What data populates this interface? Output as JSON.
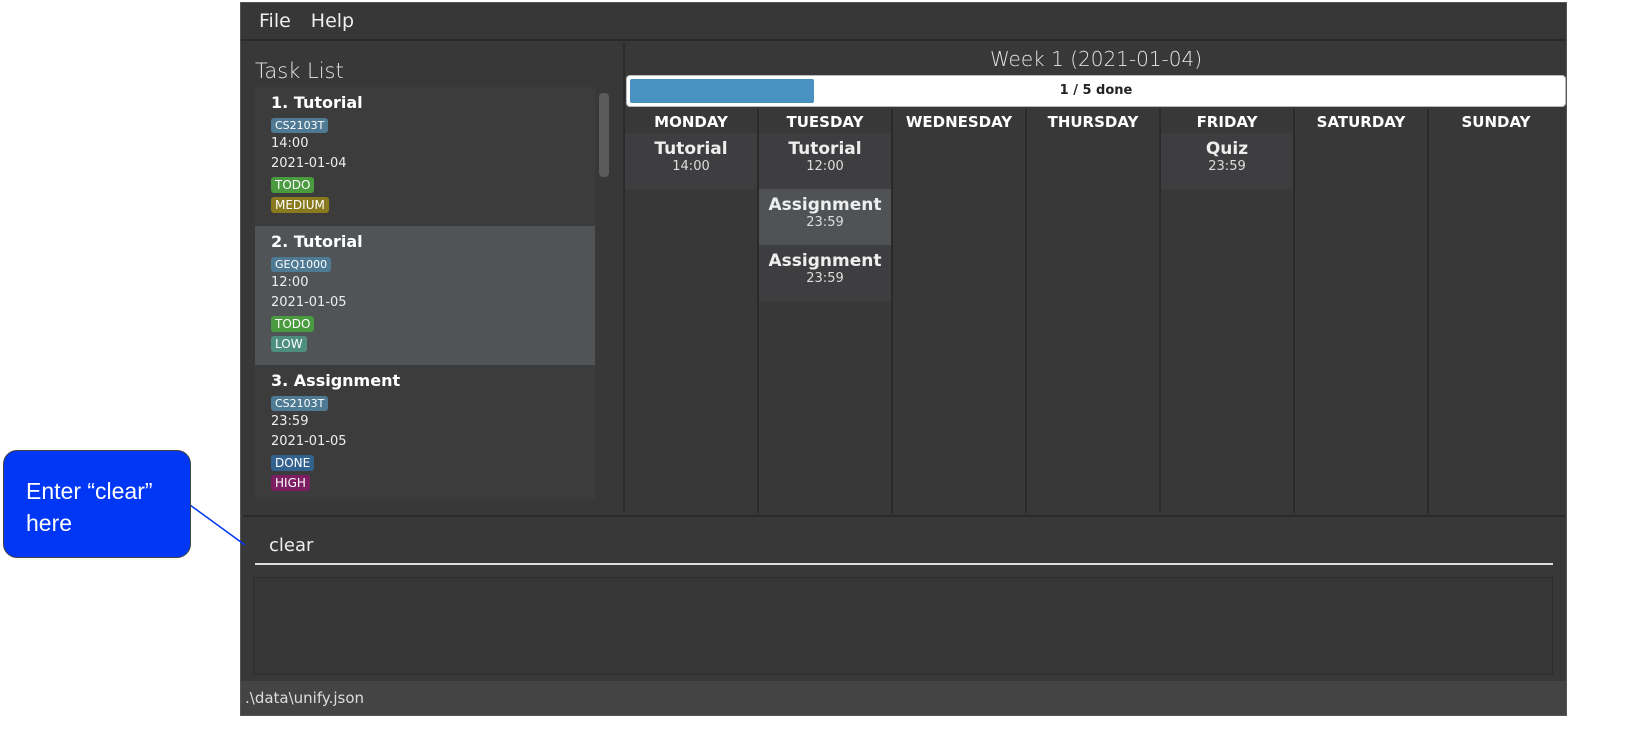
{
  "menu": {
    "file": "File",
    "help": "Help"
  },
  "task_list": {
    "title": "Task List",
    "tasks": [
      {
        "title": "1.  Tutorial",
        "module": "CS2103T",
        "time": "14:00",
        "date": "2021-01-04",
        "status": "TODO",
        "priority": "MEDIUM"
      },
      {
        "title": "2.  Tutorial",
        "module": "GEQ1000",
        "time": "12:00",
        "date": "2021-01-05",
        "status": "TODO",
        "priority": "LOW"
      },
      {
        "title": "3.  Assignment",
        "module": "CS2103T",
        "time": "23:59",
        "date": "2021-01-05",
        "status": "DONE",
        "priority": "HIGH"
      }
    ]
  },
  "calendar": {
    "week_title": "Week 1 (2021-01-04)",
    "progress_label": "1 / 5 done",
    "progress_fraction": 0.2,
    "days": [
      {
        "name": "MONDAY",
        "events": [
          {
            "name": "Tutorial",
            "time": "14:00"
          }
        ]
      },
      {
        "name": "TUESDAY",
        "events": [
          {
            "name": "Tutorial",
            "time": "12:00"
          },
          {
            "name": "Assignment",
            "time": "23:59"
          },
          {
            "name": "Assignment",
            "time": "23:59"
          }
        ]
      },
      {
        "name": "WEDNESDAY",
        "events": []
      },
      {
        "name": "THURSDAY",
        "events": []
      },
      {
        "name": "FRIDAY",
        "events": [
          {
            "name": "Quiz",
            "time": "23:59"
          }
        ]
      },
      {
        "name": "SATURDAY",
        "events": []
      },
      {
        "name": "SUNDAY",
        "events": []
      }
    ]
  },
  "command": {
    "value": "clear"
  },
  "result": {
    "text": ""
  },
  "status_bar": {
    "path": ".\\data\\unify.json"
  },
  "callout": {
    "text": "Enter “clear” here"
  },
  "colors": {
    "todo": "#4a9a3f",
    "done": "#33628f",
    "medium": "#8a7a1f",
    "low": "#4d8e7f",
    "high": "#7d1e62",
    "progress": "#4891c0",
    "callout": "#0037f5"
  }
}
